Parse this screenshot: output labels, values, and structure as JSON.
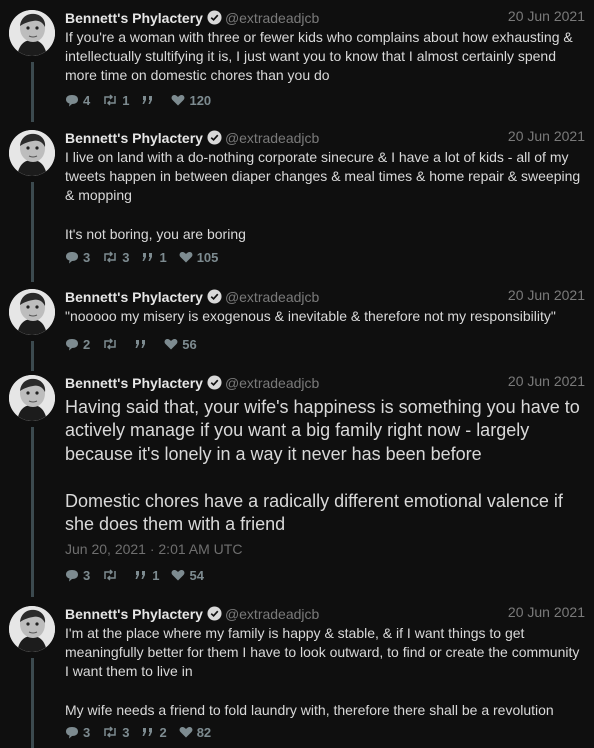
{
  "colors": {
    "background": "#0f0f0f",
    "text": "#d9d9d9",
    "muted": "#7a7a7a",
    "thread": "#3c4a4f",
    "stat": "#7d8b90"
  },
  "tweets": [
    {
      "name": "Bennett's Phylactery",
      "handle": "@extradeadjcb",
      "date": "20 Jun 2021",
      "text": "If you're a woman with three or fewer kids who complains about how exhausting & intellectually stultifying it is, I just want you to know that I almost certainly spend more time on domestic chores than you do",
      "replies": "4",
      "retweets": "1",
      "quotes": "",
      "likes": "120"
    },
    {
      "name": "Bennett's Phylactery",
      "handle": "@extradeadjcb",
      "date": "20 Jun 2021",
      "text": "I live on land with a do-nothing corporate sinecure & I have a lot of kids - all of my tweets happen in between diaper changes & meal times & home repair & sweeping & mopping\n\nIt's not boring, you are boring",
      "replies": "3",
      "retweets": "3",
      "quotes": "1",
      "likes": "105"
    },
    {
      "name": "Bennett's Phylactery",
      "handle": "@extradeadjcb",
      "date": "20 Jun 2021",
      "text": "\"nooooo my misery is exogenous & inevitable & therefore not my responsibility\"",
      "replies": "2",
      "retweets": "",
      "quotes": "",
      "likes": "56"
    },
    {
      "name": "Bennett's Phylactery",
      "handle": "@extradeadjcb",
      "date": "20 Jun 2021",
      "text": "Having said that, your wife's happiness is something you have to actively manage if you want a big family right now - largely because it's lonely in a way it never has been before\n\nDomestic chores have a radically different emotional valence if she does them with a friend",
      "timestamp": "Jun 20, 2021 · 2:01 AM UTC",
      "replies": "3",
      "retweets": "",
      "quotes": "1",
      "likes": "54"
    },
    {
      "name": "Bennett's Phylactery",
      "handle": "@extradeadjcb",
      "date": "20 Jun 2021",
      "text": "I'm at the place where my family is happy & stable, & if I want things to get meaningfully better for them I have to look outward, to find or create the community I want them to live in\n\nMy wife needs a friend to fold laundry with, therefore there shall be a revolution",
      "replies": "3",
      "retweets": "3",
      "quotes": "2",
      "likes": "82"
    }
  ]
}
